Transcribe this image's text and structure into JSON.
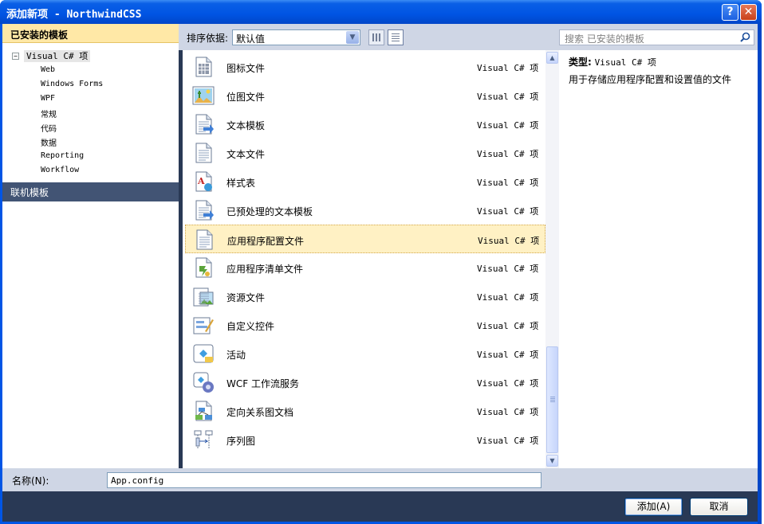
{
  "window": {
    "title": "添加新项 - NorthwindCSS",
    "help_icon": "?",
    "close_icon": "✕"
  },
  "sidebar": {
    "header": "已安装的模板",
    "root": {
      "label": "Visual C# 项",
      "toggle": "−"
    },
    "items": [
      "Web",
      "Windows Forms",
      "WPF",
      "常规",
      "代码",
      "数据",
      "Reporting",
      "Workflow"
    ],
    "online": "联机模板"
  },
  "toolbar": {
    "sort_label": "排序依据:",
    "sort_value": "默认值",
    "search_placeholder": "搜索 已安装的模板"
  },
  "templates": [
    {
      "name": "图标文件",
      "lang": "Visual C# 项",
      "icon": "icon-file-icon"
    },
    {
      "name": "位图文件",
      "lang": "Visual C# 项",
      "icon": "bitmap-file-icon"
    },
    {
      "name": "文本模板",
      "lang": "Visual C# 项",
      "icon": "text-template-icon"
    },
    {
      "name": "文本文件",
      "lang": "Visual C# 项",
      "icon": "text-file-icon"
    },
    {
      "name": "样式表",
      "lang": "Visual C# 项",
      "icon": "stylesheet-icon"
    },
    {
      "name": "已预处理的文本模板",
      "lang": "Visual C# 项",
      "icon": "preprocessed-template-icon"
    },
    {
      "name": "应用程序配置文件",
      "lang": "Visual C# 项",
      "icon": "config-file-icon",
      "selected": true
    },
    {
      "name": "应用程序清单文件",
      "lang": "Visual C# 项",
      "icon": "manifest-file-icon"
    },
    {
      "name": "资源文件",
      "lang": "Visual C# 项",
      "icon": "resource-file-icon"
    },
    {
      "name": "自定义控件",
      "lang": "Visual C# 项",
      "icon": "custom-control-icon"
    },
    {
      "name": "活动",
      "lang": "Visual C# 项",
      "icon": "activity-icon"
    },
    {
      "name": "WCF 工作流服务",
      "lang": "Visual C# 项",
      "icon": "wcf-service-icon"
    },
    {
      "name": "定向关系图文档",
      "lang": "Visual C# 项",
      "icon": "dgml-document-icon"
    },
    {
      "name": "序列图",
      "lang": "Visual C# 项",
      "icon": "sequence-diagram-icon"
    }
  ],
  "details": {
    "type_label": "类型:",
    "type_value": "Visual C# 项",
    "description": "用于存储应用程序配置和设置值的文件"
  },
  "name_field": {
    "label": "名称(N):",
    "value": "App.config"
  },
  "buttons": {
    "add": "添加(A)",
    "cancel": "取消"
  },
  "colors": {
    "title_bar": "#0054e3",
    "sidebar_header": "#ffe8a6",
    "online_templates": "#425474",
    "selected_row": "#fff1c4",
    "dialog_frame": "#293955"
  }
}
